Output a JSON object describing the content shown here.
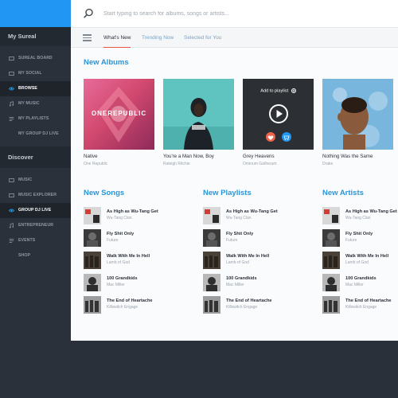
{
  "sidebar": {
    "title": "My Sureal",
    "items": [
      {
        "label": "SUREAL BOARD",
        "icon": "board-icon",
        "active": false
      },
      {
        "label": "MY SOCIAL",
        "icon": "social-icon",
        "active": false
      },
      {
        "label": "BROWSE",
        "icon": "eye-icon",
        "active": true
      },
      {
        "label": "MY MUSIC",
        "icon": "music-icon",
        "active": false
      },
      {
        "label": "MY PLAYLISTS",
        "icon": "playlist-icon",
        "active": false
      },
      {
        "label": "MY GROUP DJ LIVE",
        "icon": "",
        "active": false
      }
    ],
    "discover_title": "Discover",
    "discover_items": [
      {
        "label": "MUSIC",
        "icon": "music-icon",
        "active": false
      },
      {
        "label": "MUSIC EXPLORER",
        "icon": "explorer-icon",
        "active": false
      },
      {
        "label": "GROUP DJ LIVE",
        "icon": "eye-icon",
        "active": true
      },
      {
        "label": "ENTREPRENEUR",
        "icon": "entrepreneur-icon",
        "active": false
      },
      {
        "label": "EVENTS",
        "icon": "events-icon",
        "active": false
      },
      {
        "label": "SHOP",
        "icon": "",
        "active": false
      }
    ]
  },
  "search": {
    "placeholder": "Start typing to search for albums, songs or artists..."
  },
  "tabs": [
    {
      "label": "What's New",
      "active": true
    },
    {
      "label": "Trending Now",
      "active": false
    },
    {
      "label": "Selected for You",
      "active": false
    }
  ],
  "new_albums": {
    "title": "New Albums",
    "add_to_playlist": "Add to playlist",
    "items": [
      {
        "title": "Native",
        "artist": "One Republic"
      },
      {
        "title": "You're a Man Now, Boy",
        "artist": "Raleigh Ritchie"
      },
      {
        "title": "Grey Heavens",
        "artist": "Ominum Gatherum"
      },
      {
        "title": "Nothing Was the Same",
        "artist": "Drake"
      }
    ]
  },
  "new_songs": {
    "title": "New Songs",
    "items": [
      {
        "title": "As High as Wu-Tang Get",
        "artist": "Wu-Tang Clan"
      },
      {
        "title": "Fly Shit Only",
        "artist": "Future"
      },
      {
        "title": "Walk With Me In Hell",
        "artist": "Lamb of God"
      },
      {
        "title": "100 Grandkids",
        "artist": "Mac Miller"
      },
      {
        "title": "The End of Heartache",
        "artist": "Killswitch Engage"
      }
    ]
  },
  "new_playlists": {
    "title": "New Playlists",
    "items": [
      {
        "title": "As High as Wu-Tang Get",
        "artist": "Wu-Tang Clan"
      },
      {
        "title": "Fly Shit Only",
        "artist": "Future"
      },
      {
        "title": "Walk With Me In Hell",
        "artist": "Lamb of God"
      },
      {
        "title": "100 Grandkids",
        "artist": "Mac Miller"
      },
      {
        "title": "The End of Heartache",
        "artist": "Killswitch Engage"
      }
    ]
  },
  "new_artists": {
    "title": "New Artists",
    "items": [
      {
        "title": "As High as Wu-Tang Get",
        "artist": "Wu-Tang Clan"
      },
      {
        "title": "Fly Shit Only",
        "artist": "Future"
      },
      {
        "title": "Walk With Me In Hell",
        "artist": "Lamb of God"
      },
      {
        "title": "100 Grandkids",
        "artist": "Mac Miller"
      },
      {
        "title": "The End of Heartache",
        "artist": "Killswitch Engage"
      }
    ]
  },
  "cover_text": {
    "album1": "ONEREPUBLIC"
  },
  "colors": {
    "accent": "#2196f3",
    "heading": "#2b95d6",
    "tab_underline": "#e8553d",
    "sidebar": "#2b313a",
    "like": "#f0644c",
    "cart": "#2196f3"
  }
}
